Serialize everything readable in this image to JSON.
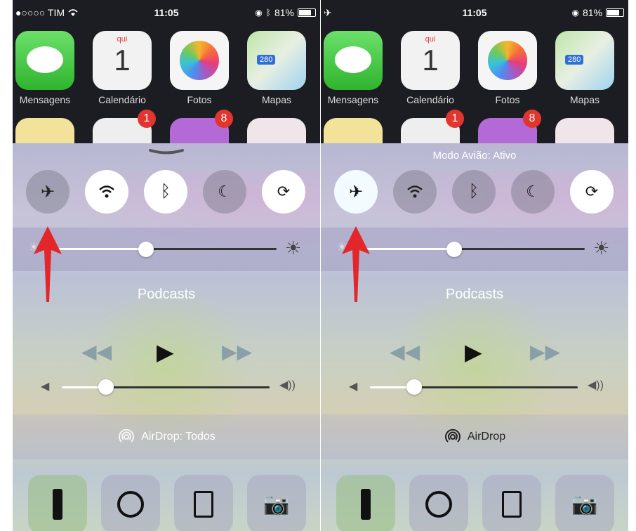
{
  "left": {
    "status": {
      "carrier": "●○○○○ TIM",
      "time": "11:05",
      "battery": "81%"
    },
    "cc_title": "",
    "airdrop_label": "AirDrop: Todos",
    "airplane_on": false
  },
  "right": {
    "status": {
      "carrier": "",
      "time": "11:05",
      "battery": "81%"
    },
    "cc_title": "Modo Avião: Ativo",
    "airdrop_label": "AirDrop",
    "airplane_on": true
  },
  "apps": [
    {
      "label": "Mensagens",
      "icon": "messages-icon"
    },
    {
      "label": "Calendário",
      "icon": "calendar-icon",
      "day": "qui",
      "date": "1"
    },
    {
      "label": "Fotos",
      "icon": "photos-icon"
    },
    {
      "label": "Mapas",
      "icon": "maps-icon",
      "route": "280"
    }
  ],
  "dock_row_badges": [
    "1",
    "8"
  ],
  "media": {
    "title": "Podcasts"
  },
  "brightness_level": 0.38,
  "volume_level": 0.2,
  "colors": {
    "airplane_arrow": "#e2262a",
    "badge": "#e0362f"
  }
}
